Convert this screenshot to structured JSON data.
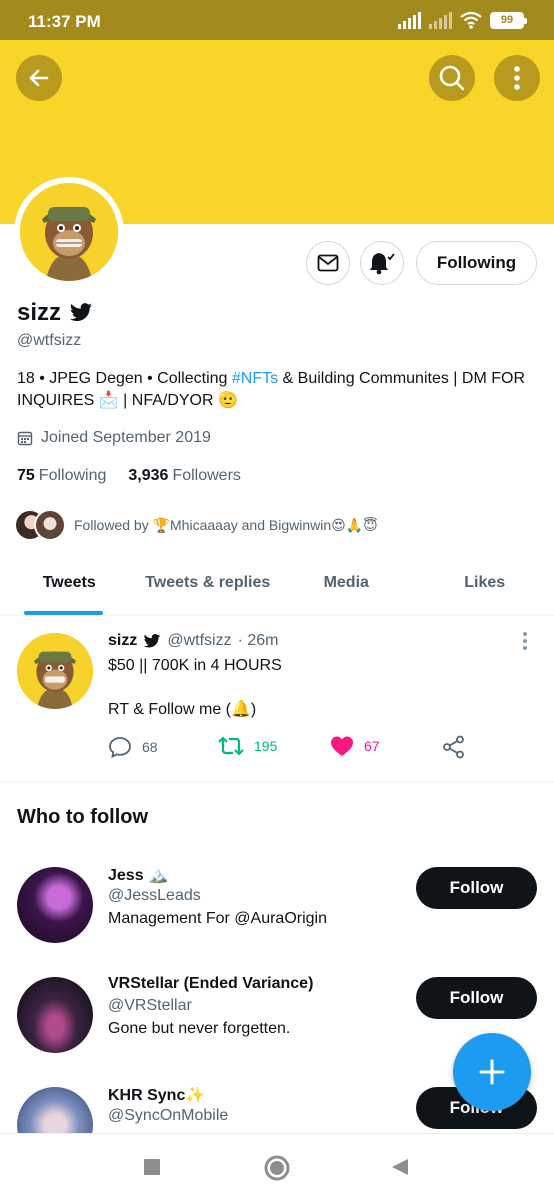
{
  "status_bar": {
    "time": "11:37 PM",
    "battery": "99"
  },
  "profile": {
    "display_name": "sizz",
    "handle": "@wtfsizz",
    "bio_parts": {
      "before_tag": "18 • JPEG Degen • Collecting ",
      "tag": "#NFTs",
      "after_tag": " & Building Communites | DM FOR INQUIRES 📩 | NFA/DYOR 🫡"
    },
    "joined": "Joined September 2019",
    "following_count": "75",
    "following_label": "Following",
    "followers_count": "3,936",
    "followers_label": "Followers",
    "followed_by": "Followed by 🏆Mhicaaaay and Bigwinwin😍🙏😇",
    "following_button": "Following"
  },
  "tabs": [
    {
      "label": "Tweets",
      "active": true
    },
    {
      "label": "Tweets & replies",
      "active": false
    },
    {
      "label": "Media",
      "active": false
    },
    {
      "label": "Likes",
      "active": false
    }
  ],
  "tweet": {
    "name": "sizz",
    "handle": "@wtfsizz",
    "time": "· 26m",
    "line1": "$50 || 700K in 4 HOURS",
    "line2": "RT & Follow me (🔔)",
    "replies": "68",
    "retweets": "195",
    "likes": "67"
  },
  "who_to_follow": {
    "title": "Who to follow",
    "people": [
      {
        "name": "Jess 🏔️",
        "handle": "@JessLeads",
        "bio": "Management For @AuraOrigin",
        "button": "Follow"
      },
      {
        "name": "VRStellar (Ended Variance)",
        "handle": "@VRStellar",
        "bio": "Gone but never forgetten.",
        "button": "Follow"
      },
      {
        "name": "KHR Sync✨",
        "handle": "@SyncOnMobile",
        "bio": "",
        "button": "Follow"
      }
    ]
  },
  "colors": {
    "banner": "#f9d529",
    "accent": "#1d9bf0",
    "retweet": "#00ba7c",
    "like": "#f91880"
  }
}
